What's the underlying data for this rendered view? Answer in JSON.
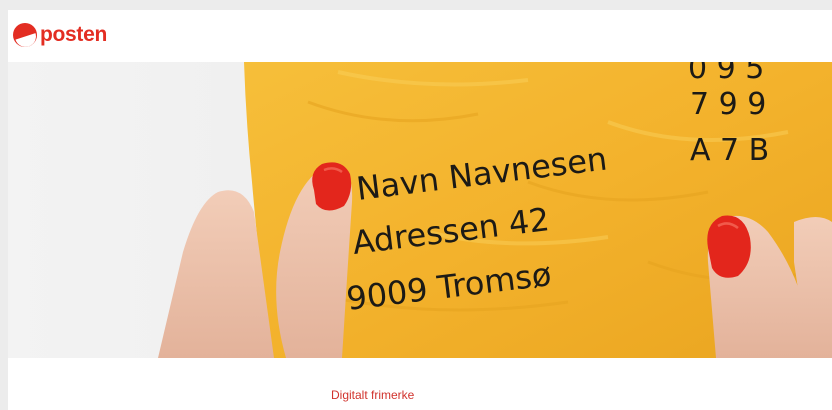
{
  "brand": {
    "name": "posten",
    "color": "#e32d22"
  },
  "hero": {
    "envelope_color": "#f4b631",
    "nail_color": "#e3261c",
    "codes": [
      "0 9 5",
      "7 9 9",
      "A 7  B"
    ],
    "address": [
      "Navn Navnesen",
      "Adressen 42",
      "9009 Tromsø"
    ]
  },
  "footer": {
    "link_label": "Digitalt frimerke",
    "link_color": "#d1332d"
  }
}
